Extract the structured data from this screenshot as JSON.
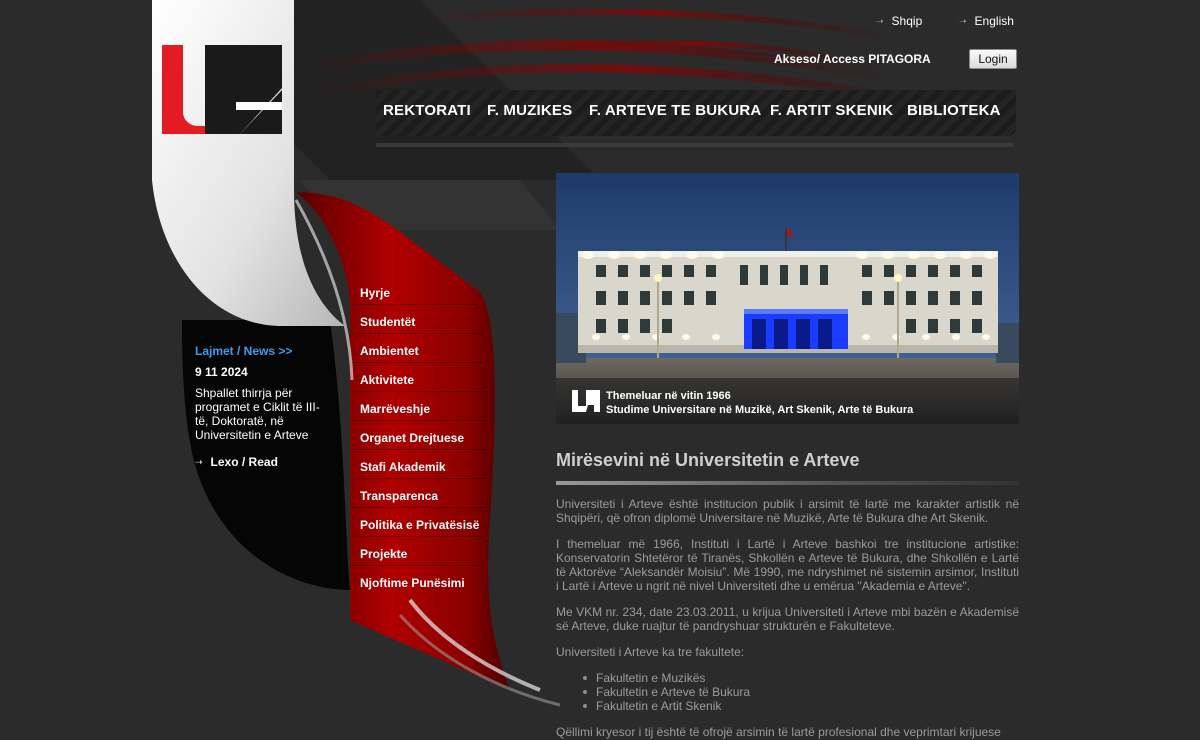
{
  "language": {
    "sq": "Shqip",
    "en": "English"
  },
  "access": {
    "label": "Akseso/ Access PITAGORA",
    "login": "Login"
  },
  "topnav": [
    "REKTORATI",
    "F. MUZIKES",
    "F. ARTEVE TE BUKURA",
    "F. ARTIT SKENIK",
    "BIBLIOTEKA"
  ],
  "sidemenu": [
    "Hyrje",
    "Studentët",
    "Ambientet",
    "Aktivitete",
    "Marrëveshje",
    "Organet Drejtuese",
    "Stafi Akademik",
    "Transparenca",
    "Politika e Privatësisë",
    "Projekte",
    "Njoftime Punësimi"
  ],
  "news": {
    "heading": "Lajmet / News >>",
    "date": "9 11 2024",
    "text": "Shpallet thirrja për programet e Ciklit të III-të, Doktoratë, në Universitetin e Arteve",
    "read": "Lexo / Read"
  },
  "hero": {
    "line1": "Themeluar në vitin 1966",
    "line2": "Studime Universitare në Muzikë, Art Skenik, Arte të Bukura"
  },
  "content": {
    "heading": "Mirësevini në Universitetin e Arteve",
    "p1": "Universiteti i Arteve është institucion publik i arsimit të lartë me karakter artistik në Shqipëri, që ofron diplomë Universitare në Muzikë, Arte të Bukura dhe Art Skenik.",
    "p2": "I themeluar më 1966, Instituti i Lartë i Arteve bashkoi tre institucione artistike: Konservatorin Shtetëror të Tiranës, Shkollën e Arteve të Bukura, dhe Shkollën e Lartë të Aktorëve “Aleksandër Moisiu”. Më 1990, me ndryshimet në sistemin arsimor, Instituti i Lartë i Arteve u ngrit në nivel Universiteti dhe u emërua \"Akademia e Arteve\".",
    "p3": "Me VKM nr. 234, date 23.03.2011, u krijua Universiteti i Arteve mbi bazën e Akademisë së Arteve, duke ruajtur të pandryshuar strukturën e Fakulteteve.",
    "p4": "Universiteti i Arteve ka tre fakultete:",
    "faculties": [
      "Fakultetin e Muzikës",
      "Fakultetin e Arteve të Bukura",
      "Fakultetin e Artit Skenik"
    ],
    "p5": "Qëllimi kryesor i tij është të ofrojë arsimin të lartë profesional dhe veprimtari krijuese"
  },
  "colors": {
    "accent_red": "#b50000",
    "link_blue": "#3b9df0",
    "bg": "#2b2b2b"
  }
}
